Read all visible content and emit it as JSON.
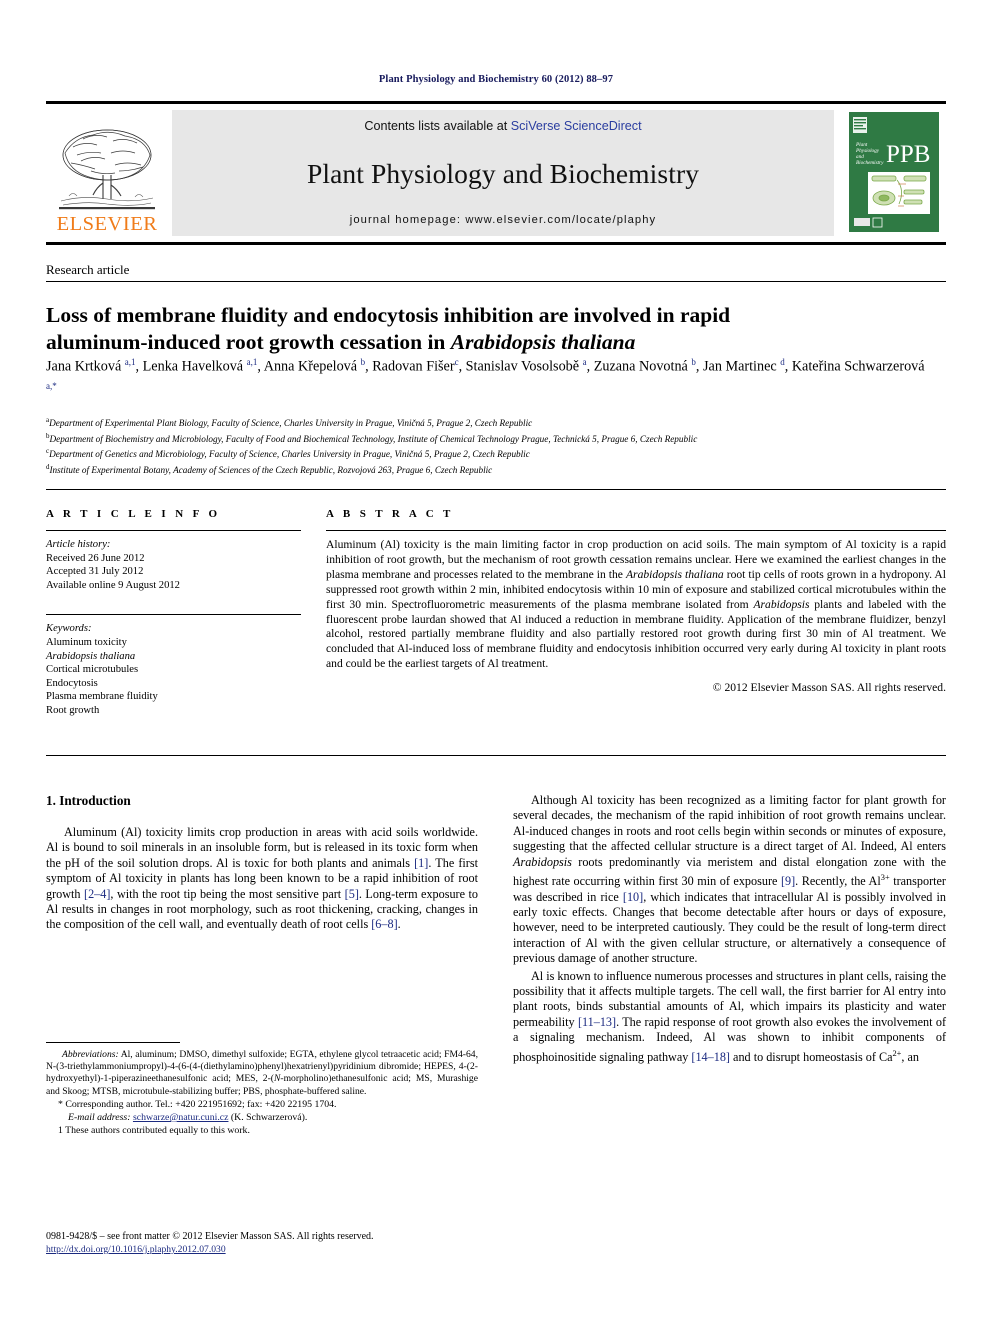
{
  "running_head": "Plant Physiology and Biochemistry 60 (2012) 88–97",
  "masthead": {
    "publisher_logo_label": "ELSEVIER",
    "contents_prefix": "Contents lists available at ",
    "contents_link": "SciVerse ScienceDirect",
    "journal_title": "Plant Physiology and Biochemistry",
    "homepage_line": "journal homepage: www.elsevier.com/locate/plaphy",
    "cover_badge": "PPB",
    "cover_caption": "Plant Physiology and Biochemistry",
    "link_color": "#2b3ea0",
    "logo_color": "#f07c1a",
    "cover_color": "#2f7a44"
  },
  "article_type": "Research article",
  "title": {
    "line1_a": "Loss of membrane fluidity and endocytosis inhibition are involved in rapid",
    "line2_a": "aluminum-induced root growth cessation in ",
    "line2_italic": "Arabidopsis thaliana"
  },
  "authors_html": "Jana Krtková <sup>a,1</sup>, Lenka Havelková <sup>a,1</sup>, Anna Křepelová <sup>b</sup>, Radovan Fišer<sup>c</sup>, Stanislav Vosolsobě <sup>a</sup>, Zuzana Novotná <sup>b</sup>, Jan Martinec <sup>d</sup>, Kateřina Schwarzerová <sup>a,</sup><sup>*</sup>",
  "affiliations": [
    {
      "mark": "a",
      "text": "Department of Experimental Plant Biology, Faculty of Science, Charles University in Prague, Viničná 5, Prague 2, Czech Republic"
    },
    {
      "mark": "b",
      "text": "Department of Biochemistry and Microbiology, Faculty of Food and Biochemical Technology, Institute of Chemical Technology Prague, Technická 5, Prague 6, Czech Republic"
    },
    {
      "mark": "c",
      "text": "Department of Genetics and Microbiology, Faculty of Science, Charles University in Prague, Viničná 5, Prague 2, Czech Republic"
    },
    {
      "mark": "d",
      "text": "Institute of Experimental Botany, Academy of Sciences of the Czech Republic, Rozvojová 263, Prague 6, Czech Republic"
    }
  ],
  "article_info": {
    "heading": "A R T I C L E    I N F O",
    "history_label": "Article history:",
    "history": [
      "Received 26 June 2012",
      "Accepted 31 July 2012",
      "Available online 9 August 2012"
    ],
    "keywords_label": "Keywords:",
    "keywords": [
      "Aluminum toxicity",
      "Arabidopsis thaliana",
      "Cortical microtubules",
      "Endocytosis",
      "Plasma membrane fluidity",
      "Root growth"
    ],
    "keyword_italic_index": 1
  },
  "abstract": {
    "heading": "A B S T R A C T",
    "p1_a": "Aluminum (Al) toxicity is the main limiting factor in crop production on acid soils. The main symptom of Al toxicity is a rapid inhibition of root growth, but the mechanism of root growth cessation remains unclear. Here we examined the earliest changes in the plasma membrane and processes related to the membrane in the ",
    "p1_italic1": "Arabidopsis thaliana",
    "p1_b": " root tip cells of roots grown in a hydropony. Al suppressed root growth within 2 min, inhibited endocytosis within 10 min of exposure and stabilized cortical microtubules within the first 30 min. Spectrofluorometric measurements of the plasma membrane isolated from ",
    "p1_italic2": "Arabidopsis",
    "p1_c": " plants and labeled with the fluorescent probe laurdan showed that Al induced a reduction in membrane fluidity. Application of the membrane fluidizer, benzyl alcohol, restored partially membrane fluidity and also partially restored root growth during first 30 min of Al treatment. We concluded that Al-induced loss of membrane fluidity and endocytosis inhibition occurred very early during Al toxicity in plant roots and could be the earliest targets of Al treatment.",
    "copyright": "© 2012 Elsevier Masson SAS. All rights reserved."
  },
  "body": {
    "section_heading": "1.  Introduction",
    "left_p1_a": "Aluminum (Al) toxicity limits crop production in areas with acid soils worldwide. Al is bound to soil minerals in an insoluble form, but is released in its toxic form when the pH of the soil solution drops. Al is toxic for both plants and animals ",
    "left_p1_ref1": "[1]",
    "left_p1_b": ". The first symptom of Al toxicity in plants has long been known to be a rapid inhibition of root growth ",
    "left_p1_ref2": "[2–4]",
    "left_p1_c": ", with the root tip being the most sensitive part ",
    "left_p1_ref3": "[5]",
    "left_p1_d": ". Long-term exposure to Al results in changes in root morphology, such as root thickening, cracking, changes in the composition of the cell wall, and eventually death of root cells ",
    "left_p1_ref4": "[6–8]",
    "left_p1_e": ".",
    "right_p1_a": "Although Al toxicity has been recognized as a limiting factor for plant growth for several decades, the mechanism of the rapid inhibition of root growth remains unclear. Al-induced changes in roots and root cells begin within seconds or minutes of exposure, suggesting that the affected cellular structure is a direct target of Al. Indeed, Al enters ",
    "right_p1_it": "Arabidopsis",
    "right_p1_b": " roots predominantly via meristem and distal elongation zone with the highest rate occurring within first 30 min of exposure ",
    "right_p1_ref1": "[9]",
    "right_p1_c": ". Recently, the Al",
    "right_p1_sup": "3+",
    "right_p1_d": " transporter was described in rice ",
    "right_p1_ref2": "[10]",
    "right_p1_e": ", which indicates that intracellular Al is possibly involved in early toxic effects. Changes that become detectable after hours or days of exposure, however, need to be interpreted cautiously. They could be the result of long-term direct interaction of Al with the given cellular structure, or alternatively a consequence of previous damage of another structure.",
    "right_p2_a": "Al is known to influence numerous processes and structures in plant cells, raising the possibility that it affects multiple targets. The cell wall, the first barrier for Al entry into plant roots, binds substantial amounts of Al, which impairs its plasticity and water permeability ",
    "right_p2_ref1": "[11–13]",
    "right_p2_b": ". The rapid response of root growth also evokes the involvement of a signaling mechanism. Indeed, Al was shown to inhibit components of phosphoinositide signaling pathway ",
    "right_p2_ref2": "[14–18]",
    "right_p2_c": " and to disrupt homeostasis of Ca",
    "right_p2_sup": "2+",
    "right_p2_d": ", an"
  },
  "footnotes": {
    "abbrev_label": "Abbreviations:",
    "abbrev_a": " Al, aluminum; DMSO, dimethyl sulfoxide; EGTA, ethylene glycol tetraacetic acid; FM4-64, N-(3-triethylammoniumpropyl)-4-(6-(4-(diethylamino)phenyl)hexatrienyl)pyridinium dibromide; HEPES, 4-(2-hydroxyethyl)-1-piperazineethanesulfonic acid; MES, 2-(",
    "abbrev_italic_n": "N",
    "abbrev_b": "-morpholino)ethanesulfonic acid; MS, Murashige and Skoog; MTSB, microtubule-stabilizing buffer; PBS, phosphate-buffered saline.",
    "corresponding": "* Corresponding author. Tel.: +420 221951692; fax: +420 22195 1704.",
    "email_label": "E-mail address:",
    "email_link": "schwarze@natur.cuni.cz",
    "email_tail": " (K. Schwarzerová).",
    "equal_contrib": "1  These authors contributed equally to this work."
  },
  "issn": {
    "line": "0981-9428/$ – see front matter © 2012 Elsevier Masson SAS. All rights reserved.",
    "doi": "http://dx.doi.org/10.1016/j.plaphy.2012.07.030"
  }
}
